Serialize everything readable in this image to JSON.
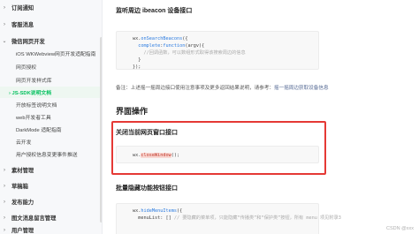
{
  "sidebar": {
    "items": [
      {
        "label": "订阅通知",
        "chevron": "›"
      },
      {
        "label": "客服消息",
        "chevron": "›"
      },
      {
        "label": "微信网页开发",
        "chevron": "⌄"
      },
      {
        "label": "iOS WKWebview网页开发适配指南"
      },
      {
        "label": "网页授权"
      },
      {
        "label": "网页开发样式库"
      },
      {
        "label": "JS-SDK说明文档",
        "prefix": "› "
      },
      {
        "label": "开放标签说明文档"
      },
      {
        "label": "web开发者工具"
      },
      {
        "label": "DarkMode 适配指南"
      },
      {
        "label": "云开发"
      },
      {
        "label": "用户授权信息变更事件推送"
      },
      {
        "label": "素材管理",
        "chevron": "›"
      },
      {
        "label": "草稿箱",
        "chevron": "›"
      },
      {
        "label": "发布能力",
        "chevron": "›"
      },
      {
        "label": "图文消息留言管理",
        "chevron": "›"
      },
      {
        "label": "用户管理",
        "chevron": "›"
      }
    ]
  },
  "content": {
    "heading_ibeacon": "监听周边 ibeacon 设备接口",
    "code1": {
      "line1_a": "wx.",
      "line1_b": "onSearchBeacons",
      "line1_c": "({",
      "line2_a": "complete",
      "line2_b": ":",
      "line2_c": "function",
      "line2_d": "(argv){",
      "line3": "//回调函数，可以数组形式取得该搜索周边的信息",
      "line4": "}",
      "line5": "});"
    },
    "note": "备注：上述摇一摇周边接口使用注意事项及更多返回结果说明，请参考：",
    "note_link": "摇一摇周边获取设备信息",
    "section_title": "界面操作",
    "heading_close": "关闭当前网页窗口接口",
    "code2": {
      "a": "wx.",
      "b": "closeWindow",
      "c": "();"
    },
    "heading_hide": "批量隐藏功能按钮接口",
    "code3": {
      "line1_a": "wx.",
      "line1_b": "hideMenuItems",
      "line1_c": "({",
      "line2_a": "menuList: [] ",
      "line2_b": "// 要隐藏的菜单项，只能隐藏“传播类”和“保护类”按钮，所有 menu 项见附录3"
    },
    "watermark": "CSDN @xxx"
  }
}
